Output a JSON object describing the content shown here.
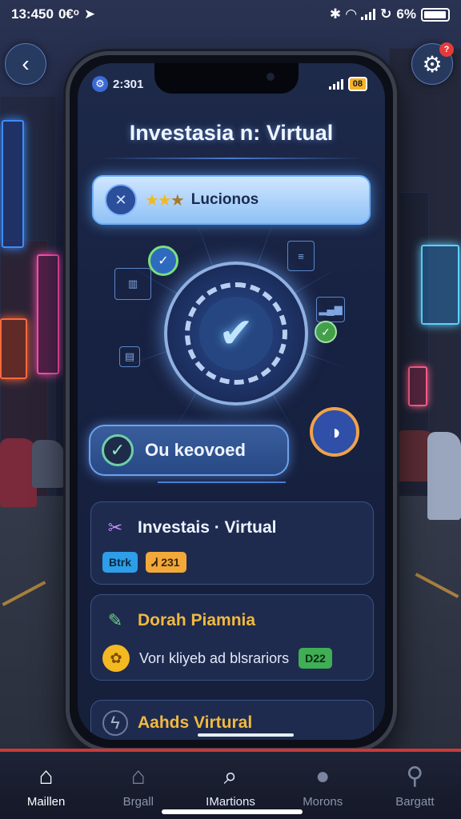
{
  "status_bar": {
    "time": "13:450",
    "left_extra": "0€ᵒ",
    "battery_pct": "6%"
  },
  "header": {
    "back_icon": "chevron-left-icon",
    "settings_icon": "gear-icon",
    "settings_badge": "?"
  },
  "phone": {
    "status_time": "2:301",
    "status_battery": "08",
    "title": "Investasia n: Virtual",
    "rating": {
      "icon": "compass-icon",
      "stars": "★★",
      "dim_star": "★",
      "label": "Lucionos"
    },
    "emblem_icon": "paper-plane-check-icon",
    "confirm": {
      "label": "Ou keovoed",
      "icon": "check-icon"
    },
    "cards": [
      {
        "icon": "tools-icon",
        "title": "Investais · Virtual",
        "pill_blue": "Btrk",
        "pill_orange": "Ꮧ 231"
      },
      {
        "icon": "pencil-icon",
        "title": "Dorah Piamnia",
        "body": "Vorı kliyeb ad blsrariors",
        "pill_green": "D22",
        "coin_symbol": "✿"
      },
      {
        "icon": "lightning-icon",
        "title": "Aahds Virtural"
      }
    ]
  },
  "bottom_nav": [
    {
      "label": "Maillen",
      "icon": "home-icon",
      "active": true
    },
    {
      "label": "Brgall",
      "icon": "house-icon",
      "active": false
    },
    {
      "label": "IMartions",
      "icon": "search-icon",
      "active": false
    },
    {
      "label": "Morons",
      "icon": "chat-icon",
      "active": false
    },
    {
      "label": "Bargatt",
      "icon": "user-icon",
      "active": false
    }
  ],
  "colors": {
    "accent": "#6ab0ff",
    "gold": "#f2b940",
    "nav_top_line": "#c83a3a"
  }
}
